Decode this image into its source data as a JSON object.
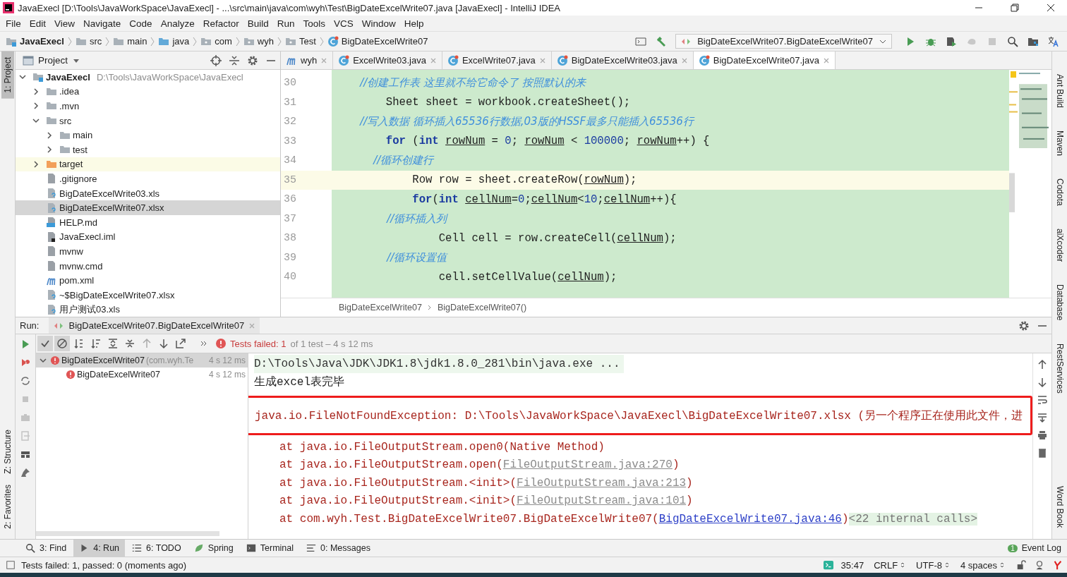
{
  "window": {
    "title": "JavaExecl [D:\\Tools\\JavaWorkSpace\\JavaExecl] - ...\\src\\main\\java\\com\\wyh\\Test\\BigDateExcelWrite07.java [JavaExecl] - IntelliJ IDEA"
  },
  "menu": [
    "File",
    "Edit",
    "View",
    "Navigate",
    "Code",
    "Analyze",
    "Refactor",
    "Build",
    "Run",
    "Tools",
    "VCS",
    "Window",
    "Help"
  ],
  "breadcrumbs": [
    {
      "label": "JavaExecl",
      "kind": "module"
    },
    {
      "label": "src",
      "kind": "folder"
    },
    {
      "label": "main",
      "kind": "folder"
    },
    {
      "label": "java",
      "kind": "source-folder"
    },
    {
      "label": "com",
      "kind": "package"
    },
    {
      "label": "wyh",
      "kind": "package"
    },
    {
      "label": "Test",
      "kind": "package"
    },
    {
      "label": "BigDateExcelWrite07",
      "kind": "class"
    }
  ],
  "run_config": {
    "label": "BigDateExcelWrite07.BigDateExcelWrite07"
  },
  "left_tool_tabs": [
    {
      "label": "1: Project",
      "selected": true
    },
    {
      "label": "Z: Structure",
      "selected": false
    },
    {
      "label": "2: Favorites",
      "selected": false
    }
  ],
  "right_tool_tabs": [
    "Ant Build",
    "Maven",
    "Codota",
    "aiXcoder",
    "Database",
    "RestServices",
    "Word Book"
  ],
  "project": {
    "title": "Project",
    "tree": [
      {
        "label": "JavaExecl",
        "path": "D:\\Tools\\JavaWorkSpace\\JavaExecl",
        "kind": "module",
        "expanded": true,
        "selected": false,
        "children": [
          {
            "label": ".idea",
            "kind": "folder",
            "expanded": false,
            "selected": false
          },
          {
            "label": ".mvn",
            "kind": "folder",
            "expanded": false,
            "selected": false
          },
          {
            "label": "src",
            "kind": "folder",
            "expanded": true,
            "selected": false,
            "children": [
              {
                "label": "main",
                "kind": "folder",
                "expanded": false,
                "selected": false
              },
              {
                "label": "test",
                "kind": "folder",
                "expanded": false,
                "selected": false
              }
            ]
          },
          {
            "label": "target",
            "kind": "excluded-folder",
            "expanded": false,
            "selected": false
          },
          {
            "label": ".gitignore",
            "kind": "text-file",
            "selected": false
          },
          {
            "label": "BigDateExcelWrite03.xls",
            "kind": "unknown-file",
            "selected": false
          },
          {
            "label": "BigDateExcelWrite07.xlsx",
            "kind": "unknown-file",
            "selected": true
          },
          {
            "label": "HELP.md",
            "kind": "markdown-file",
            "selected": false
          },
          {
            "label": "JavaExecl.iml",
            "kind": "module-file",
            "selected": false
          },
          {
            "label": "mvnw",
            "kind": "text-file",
            "selected": false
          },
          {
            "label": "mvnw.cmd",
            "kind": "text-file",
            "selected": false
          },
          {
            "label": "pom.xml",
            "kind": "maven-file",
            "selected": false
          },
          {
            "label": "~$BigDateExcelWrite07.xlsx",
            "kind": "unknown-file",
            "selected": false
          },
          {
            "label": "用户测试03.xls",
            "kind": "unknown-file",
            "selected": false
          }
        ]
      }
    ]
  },
  "editor_tabs": [
    {
      "label": "wyh",
      "kind": "maven",
      "selected": false
    },
    {
      "label": "ExcelWrite03.java",
      "kind": "class",
      "selected": false
    },
    {
      "label": "ExcelWrite07.java",
      "kind": "class",
      "selected": false
    },
    {
      "label": "BigDateExcelWrite03.java",
      "kind": "class",
      "selected": false
    },
    {
      "label": "BigDateExcelWrite07.java",
      "kind": "class",
      "selected": true
    }
  ],
  "code": [
    {
      "number": "30",
      "current": false,
      "parts": [
        {
          "kind": "comment",
          "text": "        //创建工作表 这里就不给它命令了 按照默认的来"
        }
      ]
    },
    {
      "number": "31",
      "current": false,
      "parts": [
        {
          "kind": "plain",
          "text": "        Sheet sheet = workbook.createSheet();"
        }
      ]
    },
    {
      "number": "32",
      "current": false,
      "parts": [
        {
          "kind": "comment",
          "text": "        //写入数据 循环插入65536行数据,03版的HSSF最多只能插入65536行"
        }
      ]
    },
    {
      "number": "33",
      "current": false,
      "parts": [
        {
          "kind": "keyword",
          "text": "        for"
        },
        {
          "kind": "plain",
          "text": " ("
        },
        {
          "kind": "keyword",
          "text": "int "
        },
        {
          "kind": "var",
          "text": "rowNum"
        },
        {
          "kind": "plain",
          "text": " = "
        },
        {
          "kind": "number",
          "text": "0"
        },
        {
          "kind": "plain",
          "text": "; "
        },
        {
          "kind": "var",
          "text": "rowNum"
        },
        {
          "kind": "plain",
          "text": " < "
        },
        {
          "kind": "number",
          "text": "100000"
        },
        {
          "kind": "plain",
          "text": "; "
        },
        {
          "kind": "var",
          "text": "rowNum"
        },
        {
          "kind": "plain",
          "text": "++) {"
        }
      ]
    },
    {
      "number": "34",
      "current": false,
      "parts": [
        {
          "kind": "comment",
          "text": "            //循环创建行"
        }
      ]
    },
    {
      "number": "35",
      "current": true,
      "parts": [
        {
          "kind": "plain",
          "text": "            Row row = sheet.createRow("
        },
        {
          "kind": "var",
          "text": "rowNum"
        },
        {
          "kind": "plain",
          "text": ");"
        }
      ]
    },
    {
      "number": "36",
      "current": false,
      "parts": [
        {
          "kind": "keyword",
          "text": "            for"
        },
        {
          "kind": "plain",
          "text": "("
        },
        {
          "kind": "keyword",
          "text": "int "
        },
        {
          "kind": "var",
          "text": "cellNum"
        },
        {
          "kind": "plain",
          "text": "="
        },
        {
          "kind": "number",
          "text": "0"
        },
        {
          "kind": "plain",
          "text": ";"
        },
        {
          "kind": "var",
          "text": "cellNum"
        },
        {
          "kind": "plain",
          "text": "<"
        },
        {
          "kind": "number",
          "text": "10"
        },
        {
          "kind": "plain",
          "text": ";"
        },
        {
          "kind": "var",
          "text": "cellNum"
        },
        {
          "kind": "plain",
          "text": "++){"
        }
      ]
    },
    {
      "number": "37",
      "current": false,
      "parts": [
        {
          "kind": "comment",
          "text": "                //循环插入列"
        }
      ]
    },
    {
      "number": "38",
      "current": false,
      "parts": [
        {
          "kind": "plain",
          "text": "                Cell cell = row.createCell("
        },
        {
          "kind": "var",
          "text": "cellNum"
        },
        {
          "kind": "plain",
          "text": ");"
        }
      ]
    },
    {
      "number": "39",
      "current": false,
      "parts": [
        {
          "kind": "comment",
          "text": "                //循环设置值"
        }
      ]
    },
    {
      "number": "40",
      "current": false,
      "parts": [
        {
          "kind": "plain",
          "text": "                cell.setCellValue("
        },
        {
          "kind": "var",
          "text": "cellNum"
        },
        {
          "kind": "plain",
          "text": ");"
        }
      ]
    }
  ],
  "editor_breadcrumbs": [
    "BigDateExcelWrite07",
    "BigDateExcelWrite07()"
  ],
  "run": {
    "label": "Run:",
    "tab": "BigDateExcelWrite07.BigDateExcelWrite07",
    "status_failed": "Tests failed: 1",
    "status_detail": "of 1 test – 4 s 12 ms",
    "tree": [
      {
        "label": "BigDateExcelWrite07",
        "package": "(com.wyh.Te",
        "time": "4 s 12 ms",
        "failed": true,
        "expanded": true,
        "selected": true,
        "children": [
          {
            "label": "BigDateExcelWrite07",
            "time": "4 s 12 ms",
            "failed": true,
            "selected": false
          }
        ]
      }
    ],
    "console": [
      {
        "kind": "command",
        "text": "D:\\Tools\\Java\\JDK\\JDK1.8\\jdk1.8.0_281\\bin\\java.exe ..."
      },
      {
        "kind": "output",
        "text": "生成excel表完毕"
      },
      {
        "kind": "error",
        "text": "java.io.FileNotFoundException: D:\\Tools\\JavaWorkSpace\\JavaExecl\\BigDateExcelWrite07.xlsx (另一个程序正在使用此文件，进",
        "highlighted": true
      },
      {
        "kind": "stack",
        "text": "at java.io.FileOutputStream.open0(Native Method)"
      },
      {
        "kind": "stack",
        "text": "at java.io.FileOutputStream.open(",
        "link": {
          "text": "FileOutputStream.java:270",
          "kind": "library"
        },
        "tail": ")"
      },
      {
        "kind": "stack",
        "text": "at java.io.FileOutputStream.<init>(",
        "link": {
          "text": "FileOutputStream.java:213",
          "kind": "library"
        },
        "tail": ")"
      },
      {
        "kind": "stack",
        "text": "at java.io.FileOutputStream.<init>(",
        "link": {
          "text": "FileOutputStream.java:101",
          "kind": "library"
        },
        "tail": ")"
      },
      {
        "kind": "stack",
        "text": "at com.wyh.Test.BigDateExcelWrite07.BigDateExcelWrite07(",
        "link": {
          "text": "BigDateExcelWrite07.java:46",
          "kind": "source"
        },
        "tail": ")",
        "note": "<22 internal calls>"
      }
    ]
  },
  "bottom_tabs": [
    {
      "label": "3: Find",
      "kind": "find",
      "selected": false
    },
    {
      "label": "4: Run",
      "kind": "run",
      "selected": true
    },
    {
      "label": "6: TODO",
      "kind": "todo",
      "selected": false
    },
    {
      "label": "Spring",
      "kind": "spring",
      "selected": false
    },
    {
      "label": "Terminal",
      "kind": "terminal",
      "selected": false
    },
    {
      "label": "0: Messages",
      "kind": "messages",
      "selected": false
    }
  ],
  "event_log": {
    "label": "Event Log",
    "badge": "1"
  },
  "status_bar": {
    "message": "Tests failed: 1, passed: 0 (moments ago)",
    "position": "35:47",
    "line_separator": "CRLF",
    "encoding": "UTF-8",
    "indent": "4 spaces"
  }
}
